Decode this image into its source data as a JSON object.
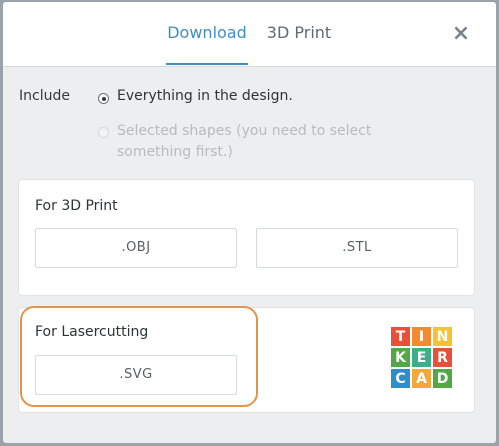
{
  "tabs": {
    "download": "Download",
    "print3d": "3D Print"
  },
  "close_symbol": "×",
  "include": {
    "label": "Include",
    "option_everything": "Everything in the design.",
    "option_selected": "Selected shapes (you need to select something first.)"
  },
  "print_section": {
    "title": "For 3D Print",
    "obj_label": ".OBJ",
    "stl_label": ".STL"
  },
  "laser_section": {
    "title": "For Lasercutting",
    "svg_label": ".SVG"
  },
  "logo": {
    "letters": [
      "T",
      "I",
      "N",
      "K",
      "E",
      "R",
      "C",
      "A",
      "D"
    ],
    "colors": [
      "#e8503a",
      "#f08b2f",
      "#f4c430",
      "#52a845",
      "#3dae8a",
      "#e8503a",
      "#2e8ec9",
      "#f4a83a",
      "#52a845"
    ]
  },
  "colors": {
    "accent": "#3f8fc6",
    "highlight": "#e4944a"
  }
}
